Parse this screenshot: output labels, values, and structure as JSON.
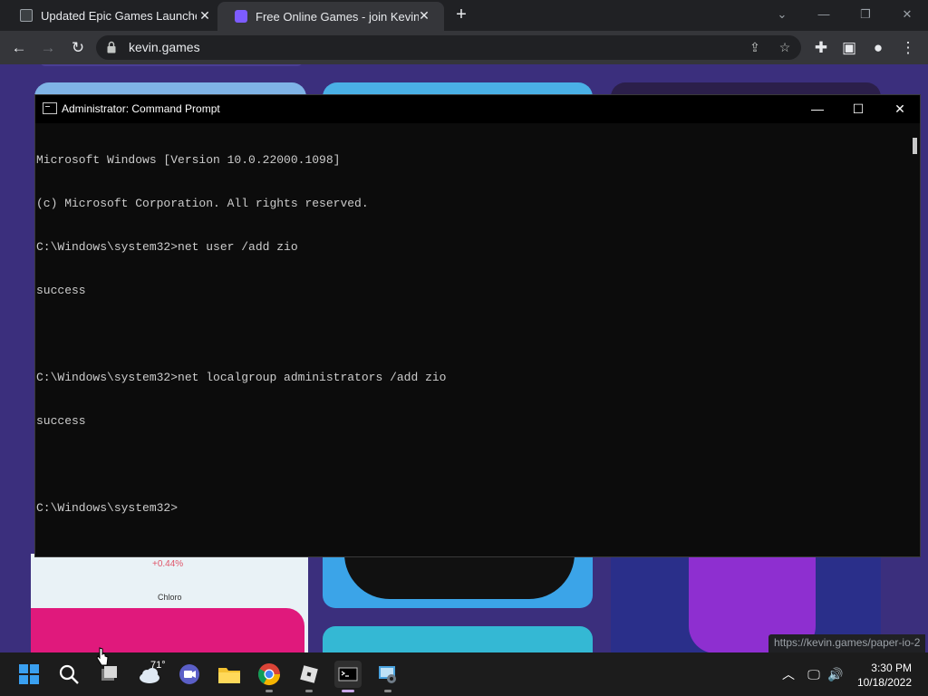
{
  "browser": {
    "tabs": [
      {
        "title": "Updated Epic Games Launcher -",
        "active": false
      },
      {
        "title": "Free Online Games - join Kevin G",
        "active": true
      }
    ],
    "url": "kevin.games",
    "status_url": "https://kevin.games/paper-io-2"
  },
  "webpage": {
    "tile_texts": [
      "+0.44%",
      "Chloro"
    ]
  },
  "cmd": {
    "title": "Administrator: Command Prompt",
    "lines": [
      "Microsoft Windows [Version 10.0.22000.1098]",
      "(c) Microsoft Corporation. All rights reserved.",
      "C:\\Windows\\system32>net user /add zio",
      "success",
      "",
      "C:\\Windows\\system32>net localgroup administrators /add zio",
      "success",
      "",
      "C:\\Windows\\system32>"
    ]
  },
  "taskbar": {
    "weather_temp": "71°",
    "time": "3:30 PM",
    "date": "10/18/2022"
  },
  "colors": {
    "accent_active_indicator": "#c9a7e8",
    "page_background": "#3b2f7d",
    "cmd_text": "#cccccc"
  }
}
